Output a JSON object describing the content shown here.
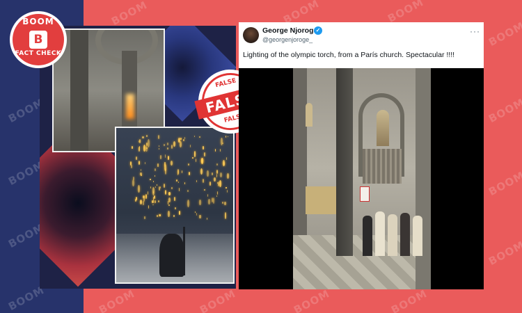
{
  "logo": {
    "top_text": "BOOM",
    "letter": "B",
    "bottom_text": "FACT CHECK"
  },
  "watermark": {
    "text": "BOOM"
  },
  "stamp": {
    "top_text": "FALSE",
    "main_text": "FALSE",
    "bottom_text": "FALSE"
  },
  "tweet": {
    "author_name": "George Njoroge",
    "verified_icon": "verified-check-icon",
    "handle": "@georgenjoroge_",
    "more_icon": "more-options-icon",
    "more_label": "···",
    "text": "Lighting of the olympic torch, from a París church. Spectacular !!!!"
  },
  "colors": {
    "navy": "#27336b",
    "red_bg": "#ea5b5b",
    "stamp_red": "#e03434",
    "verified_blue": "#1d9bf0"
  }
}
